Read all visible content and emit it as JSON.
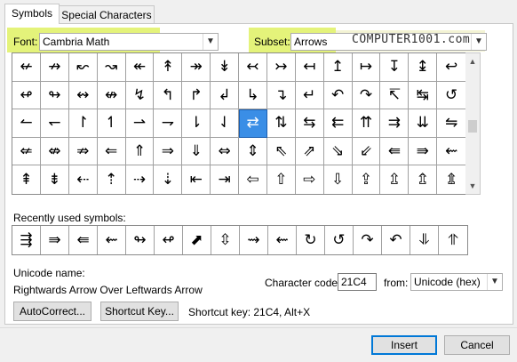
{
  "tabs": [
    {
      "label": "Symbols",
      "mnemonic": "S"
    },
    {
      "label": "Special Characters",
      "mnemonic": "P"
    }
  ],
  "font": {
    "label": "Font:",
    "value": "Cambria Math"
  },
  "subset": {
    "label": "Subset:",
    "value": "Arrows"
  },
  "watermark": "COMPUTER1001.com",
  "symbols": [
    [
      "↚",
      "↛",
      "↜",
      "↝",
      "↞",
      "↟",
      "↠",
      "↡",
      "↢",
      "↣",
      "↤",
      "↥",
      "↦",
      "↧",
      "↨",
      "↩"
    ],
    [
      "↫",
      "↬",
      "↭",
      "↮",
      "↯",
      "↰",
      "↱",
      "↲",
      "↳",
      "↴",
      "↵",
      "↶",
      "↷",
      "↸",
      "↹",
      "↺"
    ],
    [
      "↼",
      "↽",
      "↾",
      "↿",
      "⇀",
      "⇁",
      "⇂",
      "⇃",
      "⇄",
      "⇅",
      "⇆",
      "⇇",
      "⇈",
      "⇉",
      "⇊",
      "⇋"
    ],
    [
      "⇍",
      "⇎",
      "⇏",
      "⇐",
      "⇑",
      "⇒",
      "⇓",
      "⇔",
      "⇕",
      "⇖",
      "⇗",
      "⇘",
      "⇙",
      "⇚",
      "⇛",
      "⇜"
    ],
    [
      "⇞",
      "⇟",
      "⇠",
      "⇡",
      "⇢",
      "⇣",
      "⇤",
      "⇥",
      "⇦",
      "⇧",
      "⇨",
      "⇩",
      "⇪",
      "⇫",
      "⇬",
      "⇭"
    ]
  ],
  "selected": {
    "row": 2,
    "col": 8
  },
  "recent_label": "Recently used symbols:",
  "recent_symbols": [
    "⇶",
    "⇛",
    "⇚",
    "⇜",
    "↬",
    "↫",
    "⬈",
    "⇳",
    "⇝",
    "⇜",
    "↻",
    "↺",
    "↷",
    "↶",
    "⥥",
    "⥣",
    "⬉"
  ],
  "unicode_name_label": "Unicode name:",
  "unicode_name": "Rightwards Arrow Over Leftwards Arrow",
  "char_code_label": "Character code:",
  "char_code": "21C4",
  "from_label": "from:",
  "from_value": "Unicode (hex)",
  "autocorrect_label": "AutoCorrect...",
  "shortcut_key_label": "Shortcut Key...",
  "shortcut_text": "Shortcut key: 21C4, Alt+X",
  "insert_label": "Insert",
  "cancel_label": "Cancel",
  "highlight_color": "#e4f37a",
  "selection_color": "#3a8ee6"
}
